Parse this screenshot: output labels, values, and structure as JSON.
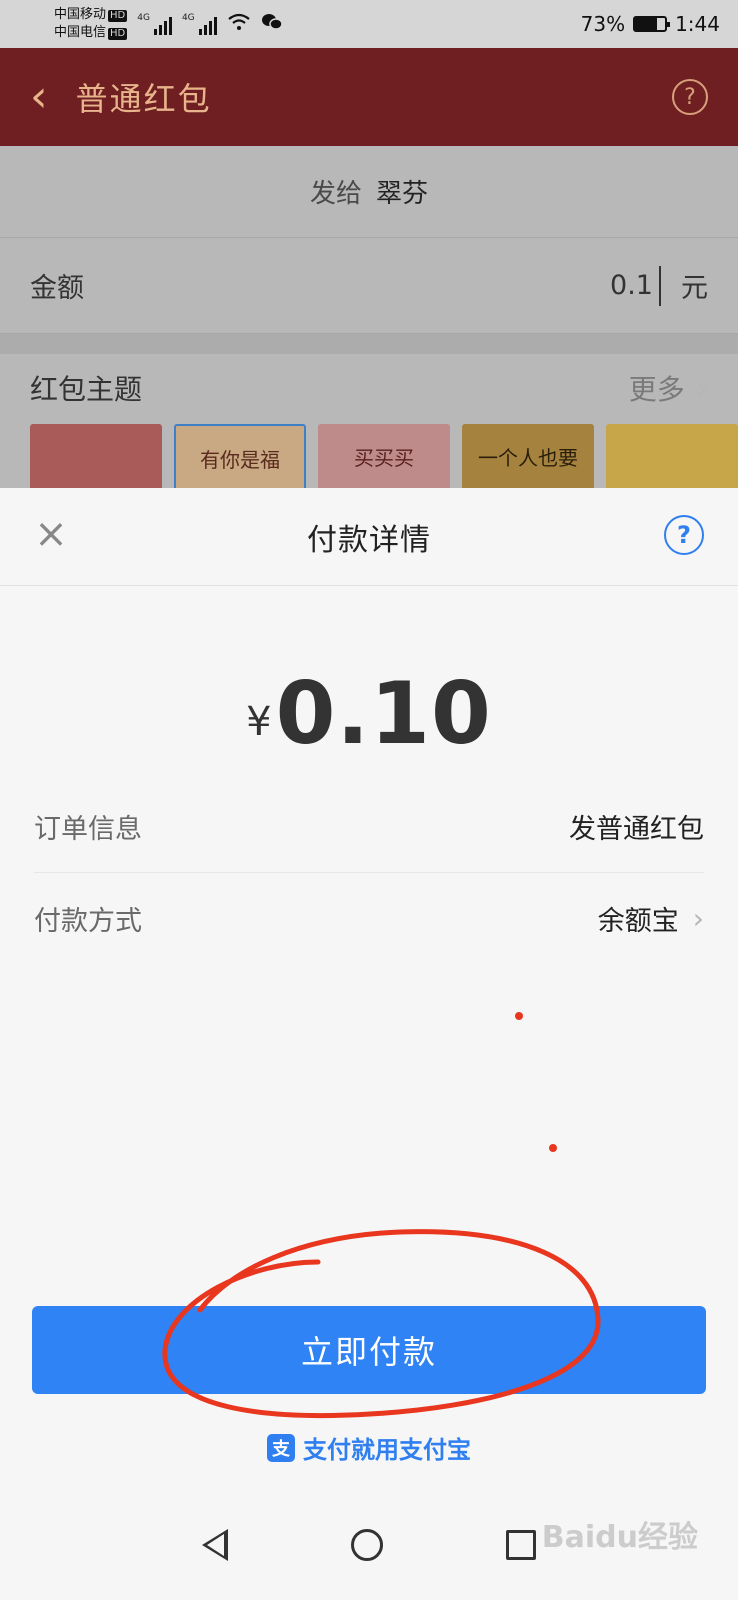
{
  "status_bar": {
    "carrier1": "中国移动",
    "carrier2": "中国电信",
    "hd": "HD",
    "network": "4G",
    "battery": "73%",
    "battery_level": 0.73,
    "time": "1:44"
  },
  "background_page": {
    "title": "普通红包",
    "to_label": "发给",
    "to_name": "翠芬",
    "amount_label": "金额",
    "amount_value": "0.1",
    "amount_unit": "元",
    "theme_label": "红包主题",
    "more_label": "更多",
    "theme_2_text": "有你是福",
    "theme_3_text": "买买买",
    "theme_4_text": "一个人也要"
  },
  "sheet": {
    "title": "付款详情",
    "currency": "¥",
    "amount": "0.10",
    "order_label": "订单信息",
    "order_value": "发普通红包",
    "pay_method_label": "付款方式",
    "pay_method_value": "余额宝",
    "pay_button": "立即付款",
    "brand_text": "支付就用支付宝",
    "brand_logo": "支"
  },
  "icons": {
    "back": "chevron-left-icon",
    "help": "question-icon",
    "close": "close-icon",
    "chevron": "chevron-right-icon"
  },
  "colors": {
    "header_red": "#6f1f22",
    "accent_blue": "#2f83f4",
    "annotation_red": "#e8361f"
  },
  "watermark": "Baidu经验"
}
